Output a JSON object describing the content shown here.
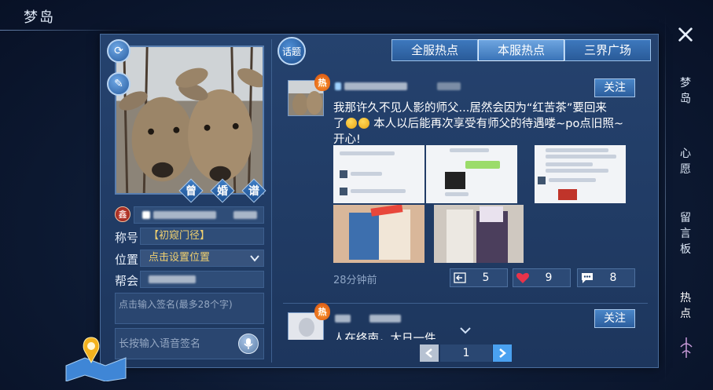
{
  "window": {
    "title": "梦岛"
  },
  "nav": {
    "items": [
      {
        "label": "梦岛",
        "chars": [
          "梦",
          "岛"
        ],
        "active": false
      },
      {
        "label": "心愿",
        "chars": [
          "心",
          "愿"
        ],
        "active": false
      },
      {
        "label": "留言板",
        "chars": [
          "留",
          "言",
          "板"
        ],
        "active": false
      },
      {
        "label": "热点",
        "chars": [
          "热",
          "点"
        ],
        "active": true
      }
    ]
  },
  "profile": {
    "actions": [
      "曾",
      "婚",
      "谱"
    ],
    "family_badge": "鑫",
    "title_label": "称号",
    "title_value": "【初窥门径】",
    "location_label": "位置",
    "location_value": "点击设置位置",
    "guild_label": "帮会",
    "signature_placeholder": "点击输入签名(最多28个字)",
    "voice_placeholder": "长按输入语音签名"
  },
  "feed": {
    "topic_badge": "话题",
    "tabs": [
      {
        "label": "全服热点",
        "active": false
      },
      {
        "label": "本服热点",
        "active": true
      },
      {
        "label": "三界广场",
        "active": false
      }
    ],
    "posts": [
      {
        "hot_badge": "热",
        "follow_label": "关注",
        "text_line1": "我那许久不见人影的师父...居然会因为“红苦茶”要回来",
        "text_line2_prefix": "了",
        "text_line2_suffix": " 本人以后能再次享受有师父的待遇喽~po点旧照~",
        "text_line3": "开心!",
        "time": "28分钟前",
        "shares": "5",
        "likes": "9",
        "comments": "8"
      },
      {
        "hot_badge": "热",
        "follow_label": "关注",
        "text_partial": "人在终南，大日一件"
      }
    ],
    "page": "1"
  },
  "colors": {
    "panel": "#1f3a62",
    "tab_active": "#6ea5e0",
    "tab": "#2f62a3",
    "hot": "#e0641a",
    "heart": "#e8334a"
  }
}
